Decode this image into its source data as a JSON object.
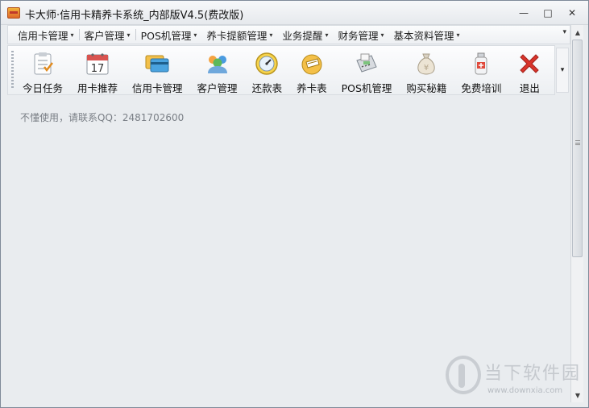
{
  "window": {
    "title": "卡大师·信用卡精养卡系统_内部版V4.5(费改版)",
    "minimize_glyph": "—",
    "maximize_glyph": "□",
    "close_glyph": "✕"
  },
  "menubar": {
    "items": [
      {
        "label": "信用卡管理"
      },
      {
        "label": "客户管理"
      },
      {
        "label": "POS机管理"
      },
      {
        "label": "养卡提额管理"
      },
      {
        "label": "业务提醒"
      },
      {
        "label": "财务管理"
      },
      {
        "label": "基本资料管理"
      }
    ],
    "arrow_glyph": "▾",
    "overflow_glyph": "▾"
  },
  "toolbar": {
    "items": [
      {
        "label": "今日任务",
        "icon": "task-list-icon"
      },
      {
        "label": "用卡推荐",
        "icon": "calendar-icon",
        "badge": "17"
      },
      {
        "label": "信用卡管理",
        "icon": "credit-card-icon"
      },
      {
        "label": "客户管理",
        "icon": "users-icon"
      },
      {
        "label": "还款表",
        "icon": "gauge-icon"
      },
      {
        "label": "养卡表",
        "icon": "card-cup-icon"
      },
      {
        "label": "POS机管理",
        "icon": "pos-terminal-icon"
      },
      {
        "label": "购买秘籍",
        "icon": "money-bag-icon"
      },
      {
        "label": "免费培训",
        "icon": "bottle-icon"
      },
      {
        "label": "退出",
        "icon": "exit-x-icon"
      }
    ],
    "overflow_glyph": "▾"
  },
  "content": {
    "hint": "不懂使用，请联系QQ：2481702600"
  },
  "scrollbar": {
    "up_glyph": "▲",
    "down_glyph": "▼"
  },
  "watermark": {
    "title": "当下软件园",
    "url": "www.downxia.com"
  },
  "colors": {
    "background": "#e9ecef",
    "exit_red": "#d9342b",
    "accent_orange": "#f0a030"
  }
}
